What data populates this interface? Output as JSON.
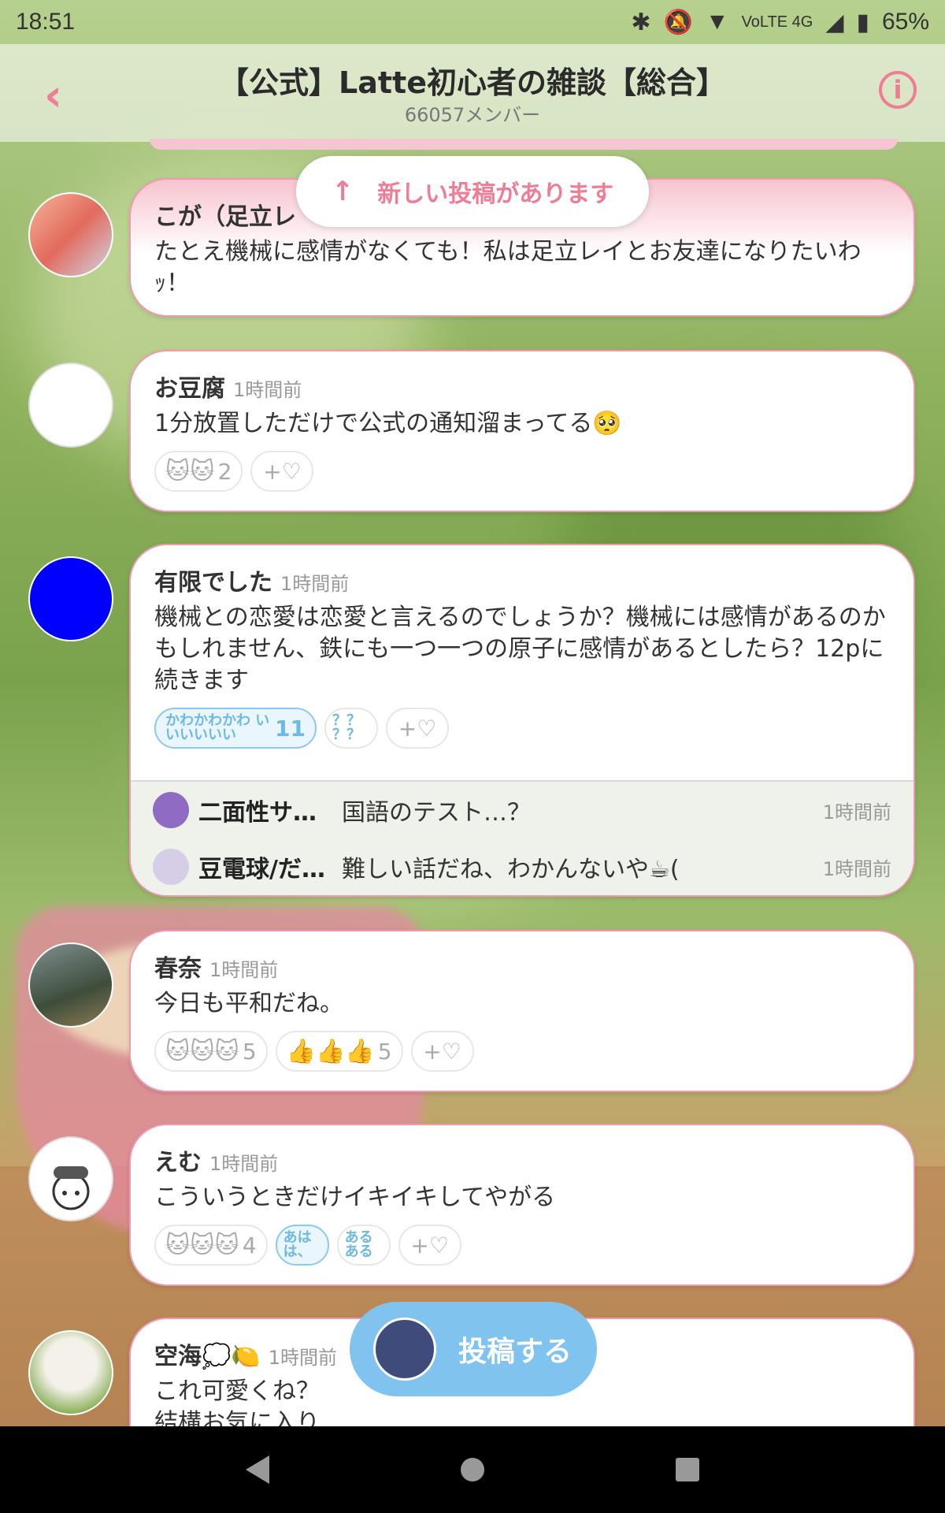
{
  "status_bar": {
    "time": "18:51",
    "network": "VoLTE 4G",
    "battery": "65%"
  },
  "header": {
    "back_icon": "chevron-left-icon",
    "title": "【公式】Latte初心者の雑談【総合】",
    "members": "66057メンバー",
    "info_icon": "info-icon"
  },
  "toast": {
    "label": "新しい投稿があります"
  },
  "posts": [
    {
      "name": "こが（足立レ",
      "time": "",
      "message": "たとえ機械に感情がなくても！私は足立レイとお友達になりたいわｯ！"
    },
    {
      "name": "お豆腐",
      "time": "1時間前",
      "message": "1分放置しただけで公式の通知溜まってる🥺",
      "reactions": [
        {
          "emoji": "🐱🐱",
          "count": "2"
        }
      ]
    },
    {
      "name": "有限でした",
      "time": "1時間前",
      "message": "機械との恋愛は恋愛と言えるのでしょうか？機械には感情があるのかもしれません、鉄にも一つ一つの原子に感情があるとしたら？12pに続きます",
      "reactions": [
        {
          "text": "かわかわかわ いいいいいい",
          "count": "11"
        },
        {
          "text": "？？ ？？"
        }
      ],
      "replies": [
        {
          "name": "二面性サ…",
          "message": "国語のテスト…？",
          "time": "1時間前"
        },
        {
          "name": "豆電球/だ…",
          "message": "難しい話だね、わかんないや☕(",
          "time": "1時間前"
        }
      ]
    },
    {
      "name": "春奈",
      "time": "1時間前",
      "message": "今日も平和だね。",
      "reactions": [
        {
          "emoji": "🐱🐱🐱",
          "count": "5"
        },
        {
          "emoji": "👍👍👍",
          "count": "5"
        }
      ]
    },
    {
      "name": "えむ",
      "time": "1時間前",
      "message": "こういうときだけイキイキしてやがる",
      "reactions": [
        {
          "emoji": "🐱🐱🐱",
          "count": "4"
        },
        {
          "text": "あは は、"
        },
        {
          "text": "ある ある"
        }
      ]
    },
    {
      "name": "空海💭🍋",
      "time": "1時間前",
      "message": "これ可愛くね？\n結構お気に入り"
    }
  ],
  "add_reaction_label": "+♡",
  "post_button": {
    "label": "投稿する"
  }
}
